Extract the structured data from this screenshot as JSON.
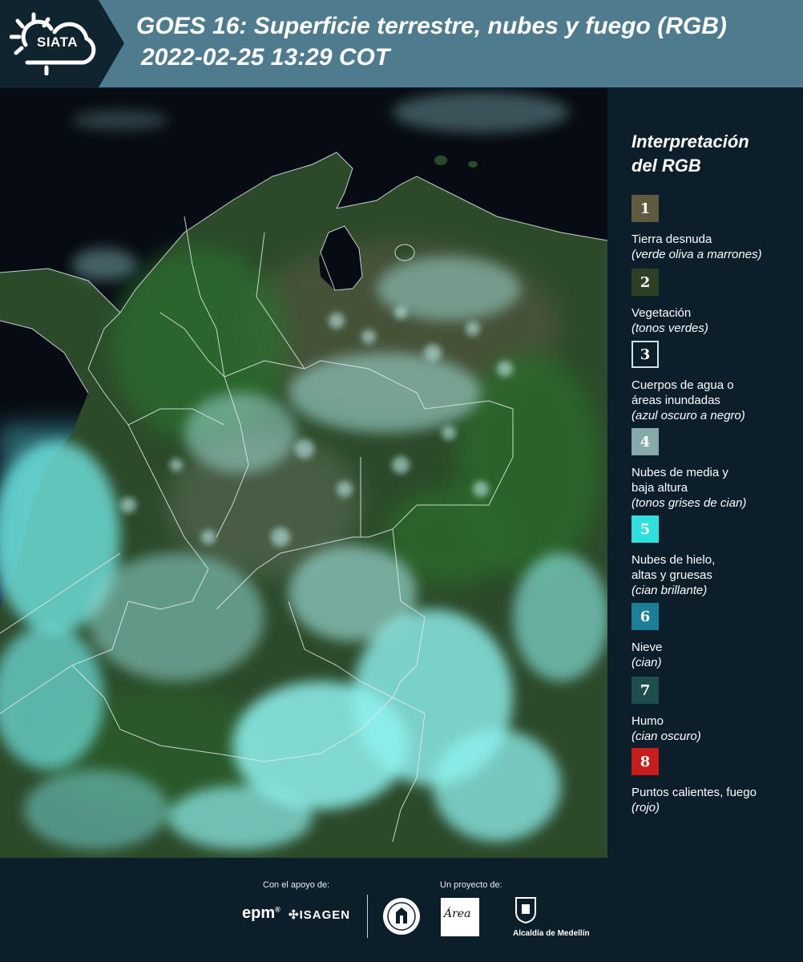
{
  "header": {
    "logo_text": "SIATA",
    "title_line1": "GOES 16: Superficie terrestre, nubes y fuego (RGB)",
    "title_line2": "2022-02-25 13:29 COT"
  },
  "legend": {
    "title_line1": "Interpretación",
    "title_line2": "del RGB",
    "items": [
      {
        "num": "1",
        "color": "#5f5b41",
        "border": "#5f5b41",
        "label": "Tierra desnuda",
        "desc": "(verde oliva a marrones)"
      },
      {
        "num": "2",
        "color": "#2d4023",
        "border": "#2d4023",
        "label": "Vegetación",
        "desc": "(tonos verdes)"
      },
      {
        "num": "3",
        "color": "#0c1e2a",
        "border": "#d8e0e4",
        "label": "Cuerpos de agua o áreas inundadas",
        "desc": "(azul oscuro a negro)"
      },
      {
        "num": "4",
        "color": "#86aaa9",
        "border": "#86aaa9",
        "label": "Nubes de media y baja altura",
        "desc": "(tonos grises de cian)"
      },
      {
        "num": "5",
        "color": "#2fe0dc",
        "border": "#2fe0dc",
        "label": "Nubes de hielo, altas y gruesas",
        "desc": "(cian brillante)"
      },
      {
        "num": "6",
        "color": "#1b7f97",
        "border": "#1b7f97",
        "label": "Nieve",
        "desc": "(cian)"
      },
      {
        "num": "7",
        "color": "#1d4d4d",
        "border": "#1d4d4d",
        "label": "Humo",
        "desc": "(cian oscuro)"
      },
      {
        "num": "8",
        "color": "#c61d1d",
        "border": "#c61d1d",
        "label": "Puntos calientes, fuego",
        "desc": "(rojo)"
      }
    ]
  },
  "footer": {
    "support_label": "Con el apoyo de:",
    "project_label": "Un proyecto de:",
    "epm": "epm",
    "isagen": "ISAGEN",
    "area_logo": "Área",
    "alcaldia": "Alcaldía de Medellín"
  },
  "colors": {
    "header_bg": "#4f7b8e",
    "page_bg": "#0c1e2a",
    "ocean": "#070c14",
    "vegetation": "#2f5a2a",
    "cloud_cyan": "#5fe6e6"
  }
}
